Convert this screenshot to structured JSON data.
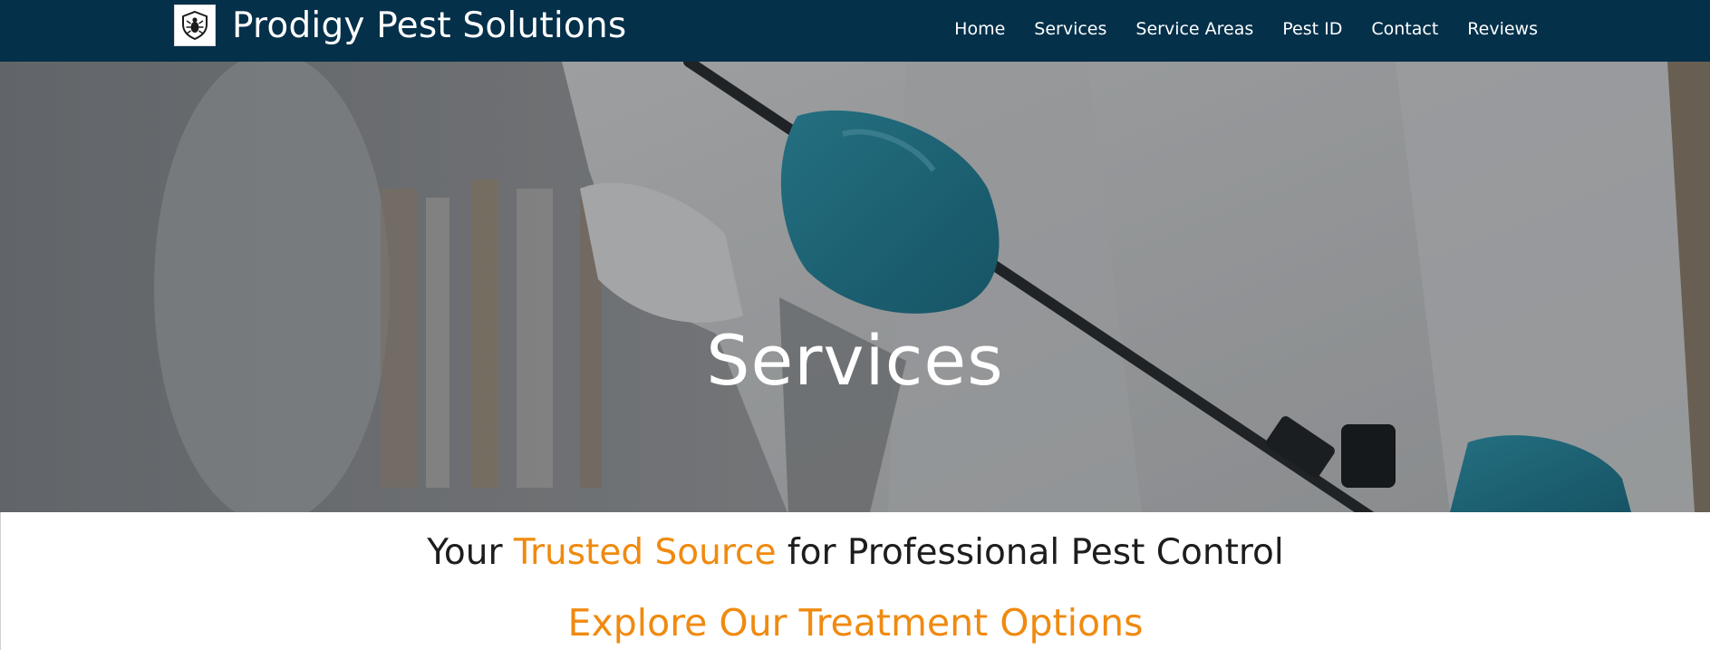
{
  "navbar": {
    "brand_title": "Prodigy Pest Solutions",
    "logo_icon": "shield-bug-icon",
    "background": "#04304a",
    "links": [
      {
        "label": "Home"
      },
      {
        "label": "Services"
      },
      {
        "label": "Service Areas"
      },
      {
        "label": "Pest ID"
      },
      {
        "label": "Contact"
      },
      {
        "label": "Reviews"
      }
    ]
  },
  "hero": {
    "title": "Services",
    "image_subject": "technician-in-protective-suit-with-sprayer"
  },
  "content": {
    "tagline": {
      "before": "Your ",
      "accent": "Trusted Source",
      "after": " for Professional Pest Control"
    },
    "subheading": "Explore Our Treatment Options",
    "accent_color": "#f08a0f"
  }
}
